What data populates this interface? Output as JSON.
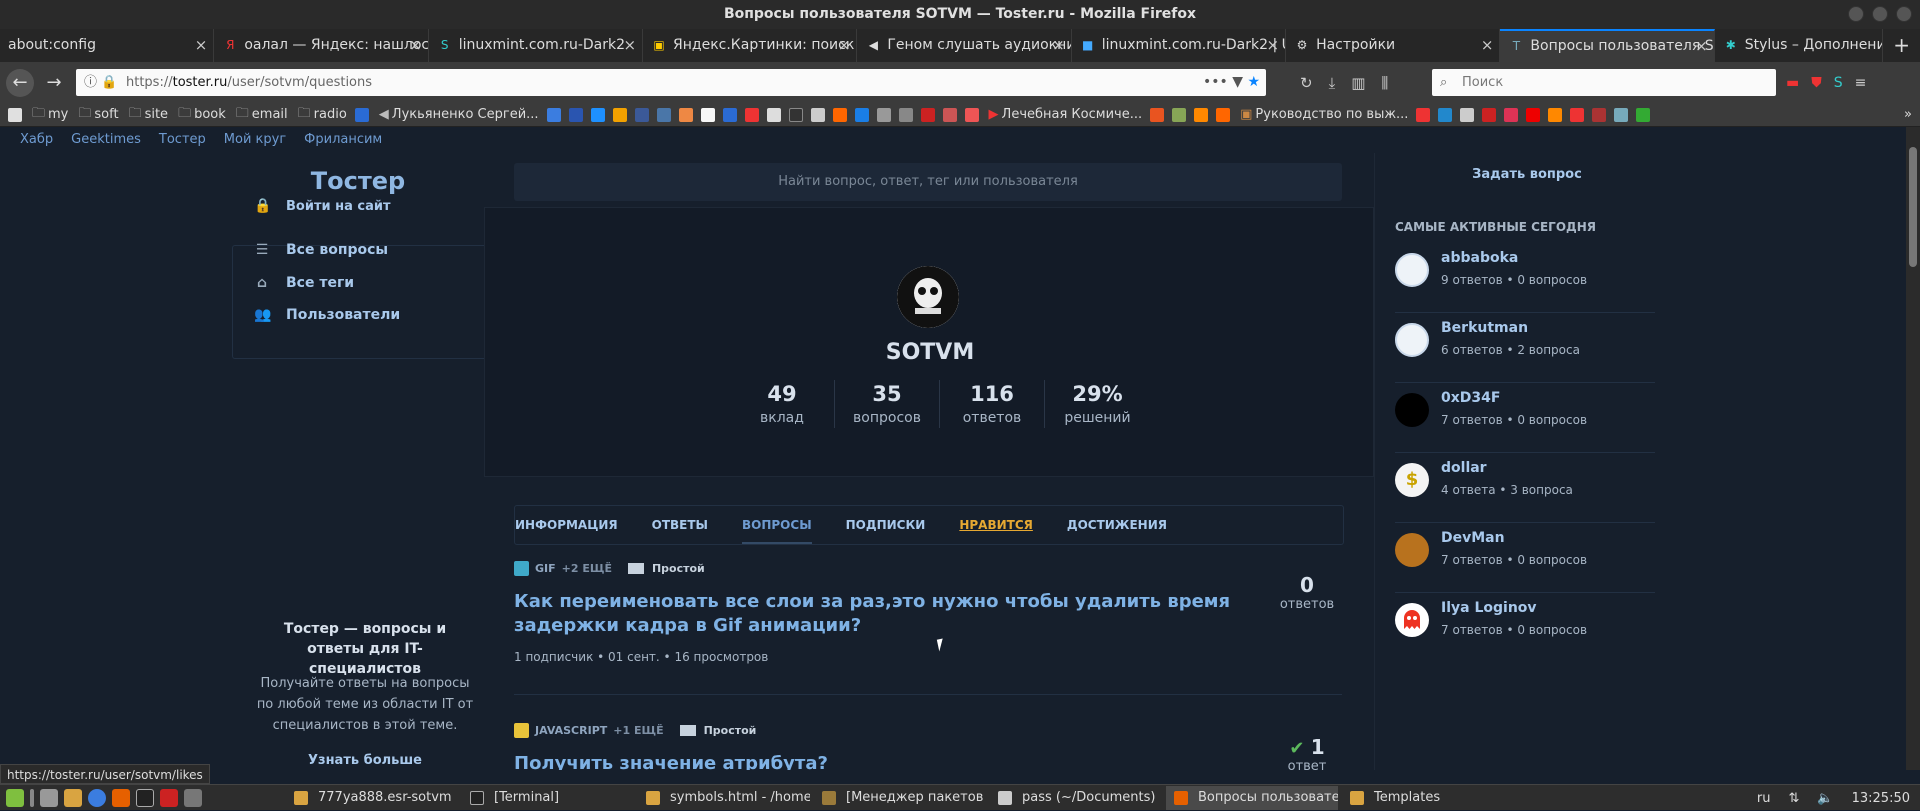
{
  "window": {
    "title": "Вопросы пользователя SOTVM — Toster.ru - Mozilla Firefox"
  },
  "tabs": [
    {
      "label": "about:config",
      "icon": "none"
    },
    {
      "label": "оалал — Яндекс: нашлос",
      "icon": "yandex-icon"
    },
    {
      "label": "linuxmint.com.ru-Dark2",
      "icon": "stylus-icon"
    },
    {
      "label": "Яндекс.Картинки: поиск",
      "icon": "yandex-images-icon"
    },
    {
      "label": "Геном слушать аудиокни",
      "icon": "audio-icon"
    },
    {
      "label": "linuxmint.com.ru-Dark2 | U",
      "icon": "userstyles-icon"
    },
    {
      "label": "Настройки",
      "icon": "gear-icon"
    },
    {
      "label": "Вопросы пользователя S",
      "icon": "toster-icon",
      "active": true
    },
    {
      "label": "Stylus – Дополнения для",
      "icon": "stylus-icon"
    }
  ],
  "urlbar": {
    "prefix": "https://",
    "domain": "toster.ru",
    "path": "/user/sotvm/questions"
  },
  "searchbar": {
    "placeholder": "Поиск"
  },
  "bookmarks": {
    "my": "my",
    "soft": "soft",
    "site": "site",
    "book": "book",
    "email": "email",
    "radio": "radio",
    "lukyanenko": "Лукьяненко Сергей...",
    "lechebnaya": "Лечебная Космиче...",
    "rukovodstvo": "Руководство по выж..."
  },
  "topnav": [
    "Хабр",
    "Geektimes",
    "Тостер",
    "Мой круг",
    "Фрилансим"
  ],
  "sidebar": {
    "logo": "Тостер",
    "login": "Войти на сайт",
    "items": [
      "Все вопросы",
      "Все теги",
      "Пользователи"
    ],
    "promo_title": "Тостер — вопросы и ответы для IT-специалистов",
    "promo_text": "Получайте ответы на вопросы по любой теме из области IT от специалистов в этой теме.",
    "promo_link": "Узнать больше"
  },
  "search": {
    "placeholder": "Найти вопрос, ответ, тег или пользователя"
  },
  "profile": {
    "name": "SOTVM",
    "stats": [
      {
        "value": "49",
        "label": "вклад"
      },
      {
        "value": "35",
        "label": "вопросов"
      },
      {
        "value": "116",
        "label": "ответов"
      },
      {
        "value": "29%",
        "label": "решений"
      }
    ],
    "tabs": [
      "ИНФОРМАЦИЯ",
      "ОТВЕТЫ",
      "ВОПРОСЫ",
      "ПОДПИСКИ",
      "НРАВИТСЯ",
      "ДОСТИЖЕНИЯ"
    ]
  },
  "questions": [
    {
      "tag": "GIF",
      "more": "+2 ЕЩЁ",
      "difficulty": "Простой",
      "title": "Как переименовать все слои за раз,это нужно чтобы удалить время задержки кадра в Gif анимации?",
      "meta": "1 подписчик • 01 сент. • 16 просмотров",
      "count": "0",
      "count_label": "ответов"
    },
    {
      "tag": "JAVASCRIPT",
      "more": "+1 ЕЩЁ",
      "difficulty": "Простой",
      "title": "Получить значение атрибута?",
      "meta": "",
      "count": "1",
      "count_label": "ответ"
    }
  ],
  "rightbar": {
    "ask": "Задать вопрос",
    "heading": "САМЫЕ АКТИВНЫЕ СЕГОДНЯ",
    "users": [
      {
        "name": "abbaboka",
        "stats": "9 ответов • 0 вопросов"
      },
      {
        "name": "Berkutman",
        "stats": "6 ответов • 2 вопроса"
      },
      {
        "name": "0xD34F",
        "stats": "7 ответов • 0 вопросов"
      },
      {
        "name": "dollar",
        "stats": "4 ответа • 3 вопроса"
      },
      {
        "name": "DevMan",
        "stats": "7 ответов • 0 вопросов"
      },
      {
        "name": "Ilya Loginov",
        "stats": "7 ответов • 0 вопросов"
      }
    ]
  },
  "statusbar": {
    "url": "https://toster.ru/user/sotvm/likes"
  },
  "taskbar": {
    "windows": [
      "777ya888.esr-sotvm",
      "[Terminal]",
      "symbols.html - /home/...",
      "[Менеджер пакетов ...",
      "pass (~/Documents)",
      "Вопросы пользовате...",
      "Templates"
    ],
    "lang": "ru",
    "clock": "13:25:50"
  },
  "colors": {
    "accent": "#a9c9ec",
    "highlight": "#e6a832",
    "background": "#161f2c"
  }
}
